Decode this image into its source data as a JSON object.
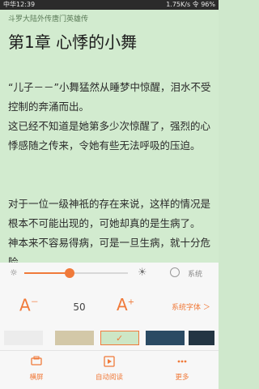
{
  "status": {
    "carrier": "中华12:39",
    "right": "1.75K/s 令 96%"
  },
  "book": {
    "title": "斗罗大陆外传唐门英雄传",
    "chapter": "第1章 心悸的小舞",
    "paragraphs": [
      "“儿子－－”小舞猛然从睡梦中惊醒，泪水不受控制的奔涌而出。",
      "这已经不知道是她第多少次惊醒了，强烈的心悸感随之传来，令她有些无法呼吸的压迫。",
      "对于一位一级神祇的存在来说，这样的情况是根本不可能出现的，可她却真的是生病了。",
      "神本来不容易得病，可是一旦生病，就十分危险。"
    ]
  },
  "brightness": {
    "level": 0.44,
    "system_label": "系统"
  },
  "font": {
    "decrease_label": "A",
    "decrease_sup": "－",
    "size": "50",
    "increase_label": "A",
    "increase_sup": "+",
    "font_link": "系统字体 ＞"
  },
  "themes": [
    "#ececec",
    "#d3c8a8",
    "#cde6c6",
    "#2a4a63",
    "#233543"
  ],
  "selected_theme": 2,
  "bottom_nav": [
    {
      "label": "横屏",
      "icon": "landscape-icon"
    },
    {
      "label": "自动阅读",
      "icon": "auto-read-icon"
    },
    {
      "label": "更多",
      "icon": "more-icon"
    }
  ],
  "colors": {
    "accent": "#f07a3a",
    "reader_bg": "#d2ebcf"
  }
}
